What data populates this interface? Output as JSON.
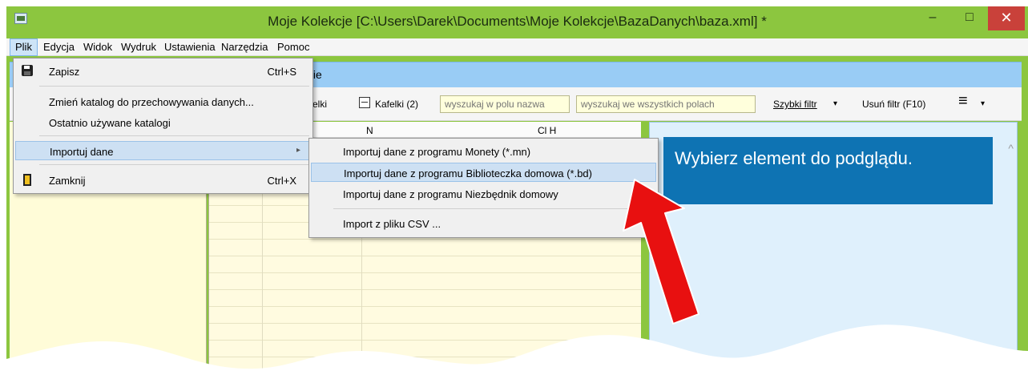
{
  "window": {
    "title": "Moje Kolekcje [C:\\Users\\Darek\\Documents\\Moje Kolekcje\\BazaDanych\\baza.xml] *",
    "minimize": "–",
    "maximize": "□",
    "close": "✕"
  },
  "menubar": {
    "items": [
      "Plik",
      "Edycja",
      "Widok",
      "Wydruk",
      "Ustawienia",
      "Narzędzia",
      "Pomoc"
    ]
  },
  "tab": {
    "label": "tkie"
  },
  "toolbar": {
    "kafelki_partial": "afelki",
    "kafelki2": "Kafelki (2)",
    "search_name_placeholder": "wyszukaj w polu nazwa",
    "search_all_placeholder": "wyszukaj we wszystkich polach",
    "quick_filter": "Szybki filtr",
    "remove_filter": "Usuń filtr (F10)",
    "menu_icon": "≡",
    "dropdown_arrow": "▾"
  },
  "list_header": {
    "col_a": "N",
    "col_b": "Cl      H"
  },
  "file_menu": {
    "items": [
      {
        "label": "Zapisz",
        "shortcut": "Ctrl+S",
        "icon": "save-icon"
      },
      {
        "label": "Zmień katalog do przechowywania danych...",
        "shortcut": ""
      },
      {
        "label": "Ostatnio używane katalogi",
        "shortcut": ""
      },
      {
        "label": "Importuj dane",
        "shortcut": "",
        "has_submenu": true,
        "arrow": "▸"
      },
      {
        "label": "Zamknij",
        "shortcut": "Ctrl+X",
        "icon": "exit-icon"
      }
    ]
  },
  "import_submenu": {
    "items": [
      {
        "label": "Importuj dane z programu Monety (*.mn)"
      },
      {
        "label": "Importuj dane z programu Biblioteczka domowa (*.bd)"
      },
      {
        "label": "Importuj dane z programu Niezbędnik domowy"
      },
      {
        "label": "Import z pliku CSV ..."
      }
    ]
  },
  "preview": {
    "message": "Wybierz element do podglądu.",
    "scroll_up": "^"
  },
  "colors": {
    "title_bar": "#8cc63f",
    "tab_strip": "#99ccf5",
    "preview_box": "#0e73b3",
    "arrow": "#e81010",
    "close_button": "#c9413a"
  }
}
